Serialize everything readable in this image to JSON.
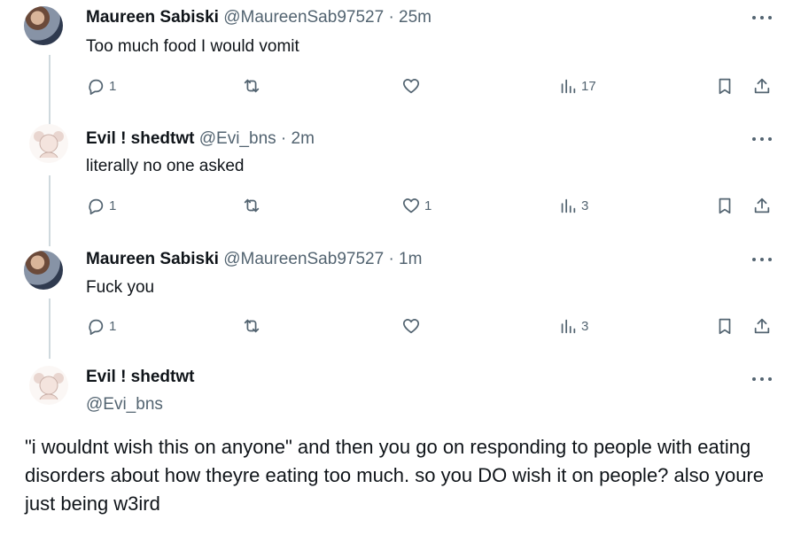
{
  "tweets": [
    {
      "name": "Maureen Sabiski",
      "handle": "@MaureenSab97527",
      "time": "25m",
      "text": "Too much food I would vomit",
      "replies": "1",
      "retweets": "",
      "likes": "",
      "views": "17"
    },
    {
      "name": "Evil ! shedtwt",
      "handle": "@Evi_bns",
      "time": "2m",
      "text": "literally no one asked",
      "replies": "1",
      "retweets": "",
      "likes": "1",
      "views": "3"
    },
    {
      "name": "Maureen Sabiski",
      "handle": "@MaureenSab97527",
      "time": "1m",
      "text": "Fuck you",
      "replies": "1",
      "retweets": "",
      "likes": "",
      "views": "3"
    }
  ],
  "main_tweet": {
    "name": "Evil ! shedtwt",
    "handle": "@Evi_bns",
    "text": "\"i wouldnt wish this on anyone\" and then you go on responding to people with eating disorders about how theyre eating too much. so you DO wish it on people? also youre just being w3ird"
  },
  "separator": "·",
  "icons": [
    "reply-icon",
    "retweet-icon",
    "like-icon",
    "views-icon",
    "bookmark-icon",
    "share-icon",
    "more-icon"
  ]
}
